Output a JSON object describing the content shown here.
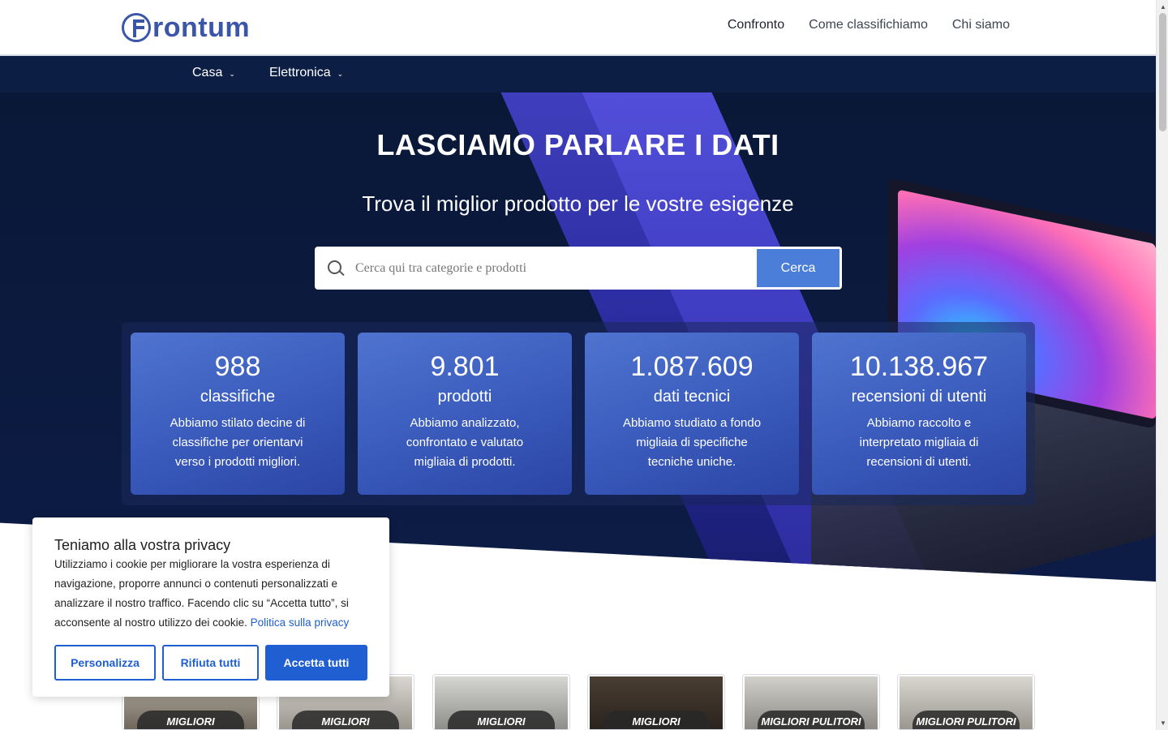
{
  "header": {
    "logo_text": "rontum",
    "nav": [
      {
        "label": "Confronto"
      },
      {
        "label": "Come classifichiamo"
      },
      {
        "label": "Chi siamo"
      }
    ]
  },
  "categories": [
    {
      "label": "Casa"
    },
    {
      "label": "Elettronica"
    }
  ],
  "hero": {
    "title": "LASCIAMO PARLARE I DATI",
    "subtitle": "Trova il miglior prodotto per le vostre esigenze",
    "search_placeholder": "Cerca qui tra categorie e prodotti",
    "search_button": "Cerca"
  },
  "stats": [
    {
      "number": "988",
      "label": "classifiche",
      "desc": "Abbiamo stilato decine di classifiche per orientarvi verso i prodotti migliori."
    },
    {
      "number": "9.801",
      "label": "prodotti",
      "desc": "Abbiamo analizzato, confrontato e valutato migliaia di prodotti."
    },
    {
      "number": "1.087.609",
      "label": "dati tecnici",
      "desc": "Abbiamo studiato a fondo migliaia di specifiche tecniche uniche."
    },
    {
      "number": "10.138.967",
      "label": "recensioni di utenti",
      "desc": "Abbiamo raccolto e interpretato migliaia di recensioni di utenti."
    }
  ],
  "tiles": [
    {
      "label": "MIGLIORI"
    },
    {
      "label": "MIGLIORI CONDIZIONATORI"
    },
    {
      "label": "MIGLIORI"
    },
    {
      "label": "MIGLIORI"
    },
    {
      "label": "MIGLIORI PULITORI A"
    },
    {
      "label": "MIGLIORI PULITORI"
    }
  ],
  "cookie": {
    "title": "Teniamo alla vostra privacy",
    "text": "Utilizziamo i cookie per migliorare la vostra esperienza di navigazione, proporre annunci o contenuti personalizzati e analizzare il nostro traffico. Facendo clic su “Accetta tutto”, si acconsente al nostro utilizzo dei cookie.",
    "link": "Politica sulla privacy",
    "buttons": {
      "customize": "Personalizza",
      "reject": "Rifiuta tutti",
      "accept": "Accetta tutti"
    }
  },
  "colors": {
    "brand": "#3b56a8",
    "nav_bar": "#0c1e44",
    "accent_button": "#1f5fd1",
    "search_button": "#4a7ed8"
  }
}
